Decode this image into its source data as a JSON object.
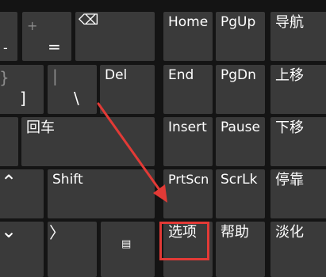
{
  "keys": {
    "row1": {
      "plus_top": "+",
      "equals": "=",
      "backspace_icon": "⌫",
      "home": "Home",
      "pgup": "PgUp",
      "nav": "导航"
    },
    "row2": {
      "brace_top": "}",
      "bracket": "]",
      "pipe_top": "|",
      "backslash": "\\",
      "del": "Del",
      "end": "End",
      "pgdn": "PgDn",
      "move_up": "上移"
    },
    "row3": {
      "enter": "回车",
      "insert": "Insert",
      "pause": "Pause",
      "move_down": "下移"
    },
    "row4": {
      "up_arrow": "⌃",
      "shift": "Shift",
      "prtscn": "PrtScn",
      "scrlk": "ScrLk",
      "dock": "停靠"
    },
    "row5": {
      "down_arrow": "⌄",
      "right_arrow": "〉",
      "menu_icon": "▤",
      "options": "选项",
      "help": "帮助",
      "fade": "淡化"
    }
  },
  "annotation": {
    "arrow_color": "#e23a36",
    "box_color": "#e23a36"
  }
}
